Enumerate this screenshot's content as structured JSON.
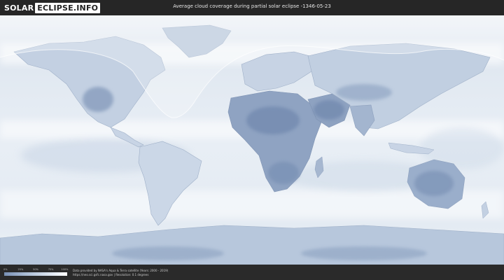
{
  "header": {
    "logo_part1": "SOLAR",
    "logo_part2": "ECLIPSE.INFO",
    "title": "Average cloud coverage during partial solar eclipse -1346-05-23"
  },
  "footer": {
    "legend_ticks": [
      "0%",
      "25%",
      "50%",
      "75%",
      "100%"
    ],
    "credit_line1": "Data provided by NASA's Aqua & Terra satellite (Years: 2000 - 2019)",
    "credit_line2": "https://neo.sci.gsfc.nasa.gov  |  Resolution: 0.1 degrees"
  },
  "colors": {
    "background": "#2a2a2a",
    "cloud_clear": "#7890b4",
    "cloud_full": "#ffffff"
  }
}
